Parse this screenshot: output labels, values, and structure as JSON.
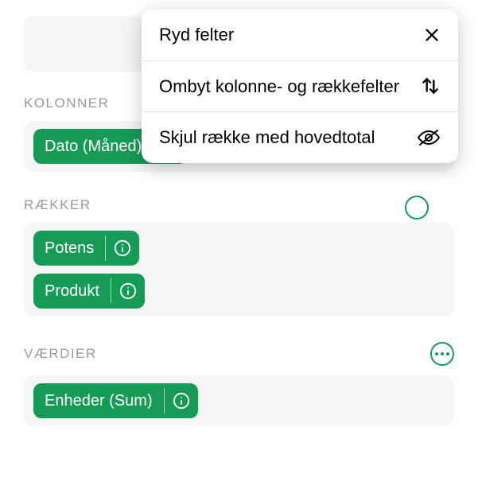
{
  "sections": {
    "columns": {
      "label": "KOLONNER",
      "pills": [
        {
          "label": "Dato (Måned)"
        }
      ]
    },
    "rows": {
      "label": "RÆKKER",
      "pills": [
        {
          "label": "Potens"
        },
        {
          "label": "Produkt"
        }
      ]
    },
    "values": {
      "label": "VÆRDIER",
      "pills": [
        {
          "label": "Enheder (Sum)"
        }
      ]
    }
  },
  "popup": {
    "clear": "Ryd felter",
    "swap": "Ombyt kolonne- og rækkefelter",
    "hide": "Skjul række med hovedtotal"
  }
}
